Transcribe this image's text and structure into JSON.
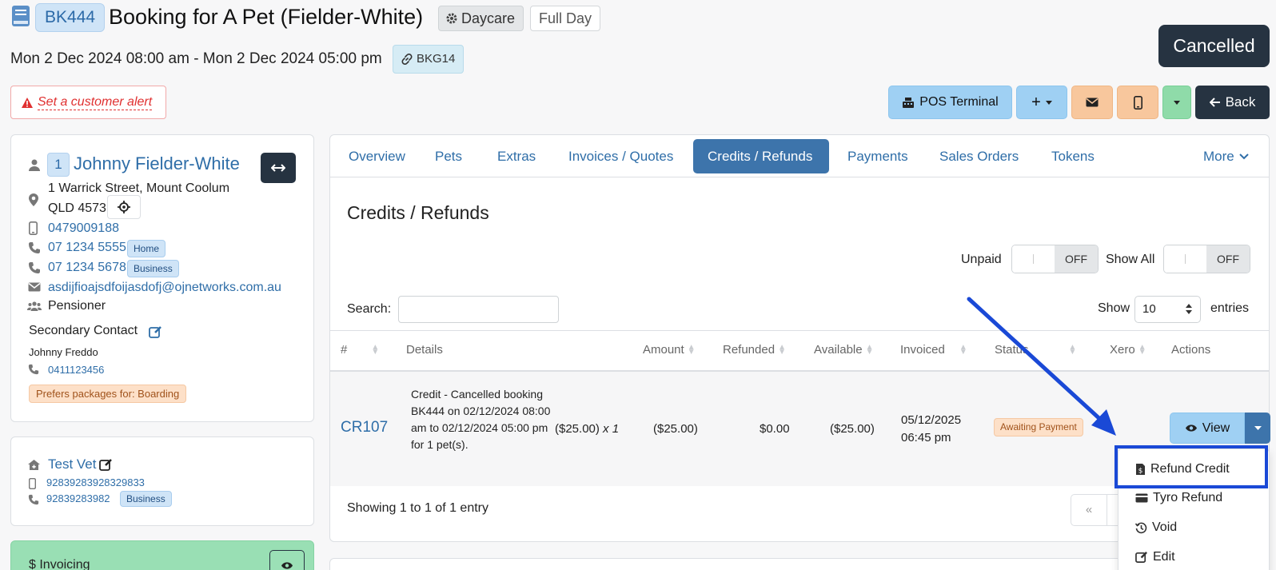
{
  "header": {
    "booking_id": "BK444",
    "title": "Booking for A Pet (Fielder-White)",
    "service": "Daycare",
    "length": "Full Day",
    "dates": "Mon 2 Dec 2024 08:00 am - Mon 2 Dec 2024 05:00 pm",
    "link_ref": "BKG14",
    "status": "Cancelled",
    "alert_label": "Set a customer alert"
  },
  "toolbar": {
    "pos_label": "POS Terminal",
    "plus_label": "+",
    "back_label": "Back"
  },
  "customer": {
    "number": "1",
    "name": "Johnny Fielder-White",
    "address_line1": "1 Warrick Street, Mount Coolum",
    "address_line2": "QLD 4573",
    "mobile": "0479009188",
    "phone_home": "07 1234 5555",
    "phone_home_tag": "Home",
    "phone_business": "07 1234 5678",
    "phone_business_tag": "Business",
    "email": "asdijfioajsdfoijasdofj@ojnetworks.com.au",
    "concession": "Pensioner",
    "secondary_heading": "Secondary Contact",
    "secondary_name": "Johnny Freddo",
    "secondary_phone": "0411123456",
    "preference": "Prefers packages for: Boarding"
  },
  "vet": {
    "name": "Test Vet",
    "mobile": "92839283928329833",
    "phone": "92839283982",
    "phone_tag": "Business"
  },
  "invoicing": {
    "label": "Invoicing"
  },
  "tabs": [
    {
      "label": "Overview"
    },
    {
      "label": "Pets"
    },
    {
      "label": "Extras"
    },
    {
      "label": "Invoices / Quotes"
    },
    {
      "label": "Credits / Refunds"
    },
    {
      "label": "Payments"
    },
    {
      "label": "Sales Orders"
    },
    {
      "label": "Tokens"
    },
    {
      "label": "More"
    }
  ],
  "credits": {
    "title": "Credits / Refunds",
    "unpaid_label": "Unpaid",
    "show_all_label": "Show All",
    "toggle_off": "OFF",
    "search_label": "Search:",
    "search_value": "",
    "show_label": "Show",
    "entries_value": "10",
    "entries_label": "entries",
    "columns": [
      "#",
      "Details",
      "Amount",
      "Refunded",
      "Available",
      "Invoiced",
      "Status",
      "Xero",
      "Actions"
    ],
    "rows": [
      {
        "id": "CR107",
        "details": "Credit - Cancelled booking BK444 on 02/12/2024 08:00 am to 02/12/2024 05:00 pm for 1 pet(s).",
        "unit": "($25.00)",
        "qty": "x 1",
        "amount": "($25.00)",
        "refunded": "$0.00",
        "available": "($25.00)",
        "invoiced_date": "05/12/2025",
        "invoiced_time": "06:45 pm",
        "status": "Awaiting Payment",
        "action": "View"
      }
    ],
    "showing": "Showing 1 to 1 of 1 entry",
    "pager_prev": "«"
  },
  "action_menu": {
    "items": [
      {
        "label": "Refund Credit"
      },
      {
        "label": "Tyro Refund"
      },
      {
        "label": "Void"
      },
      {
        "label": "Edit"
      }
    ]
  },
  "colors": {
    "accent": "#3d74ab",
    "highlight": "#1a49d6",
    "dark": "#263341"
  }
}
